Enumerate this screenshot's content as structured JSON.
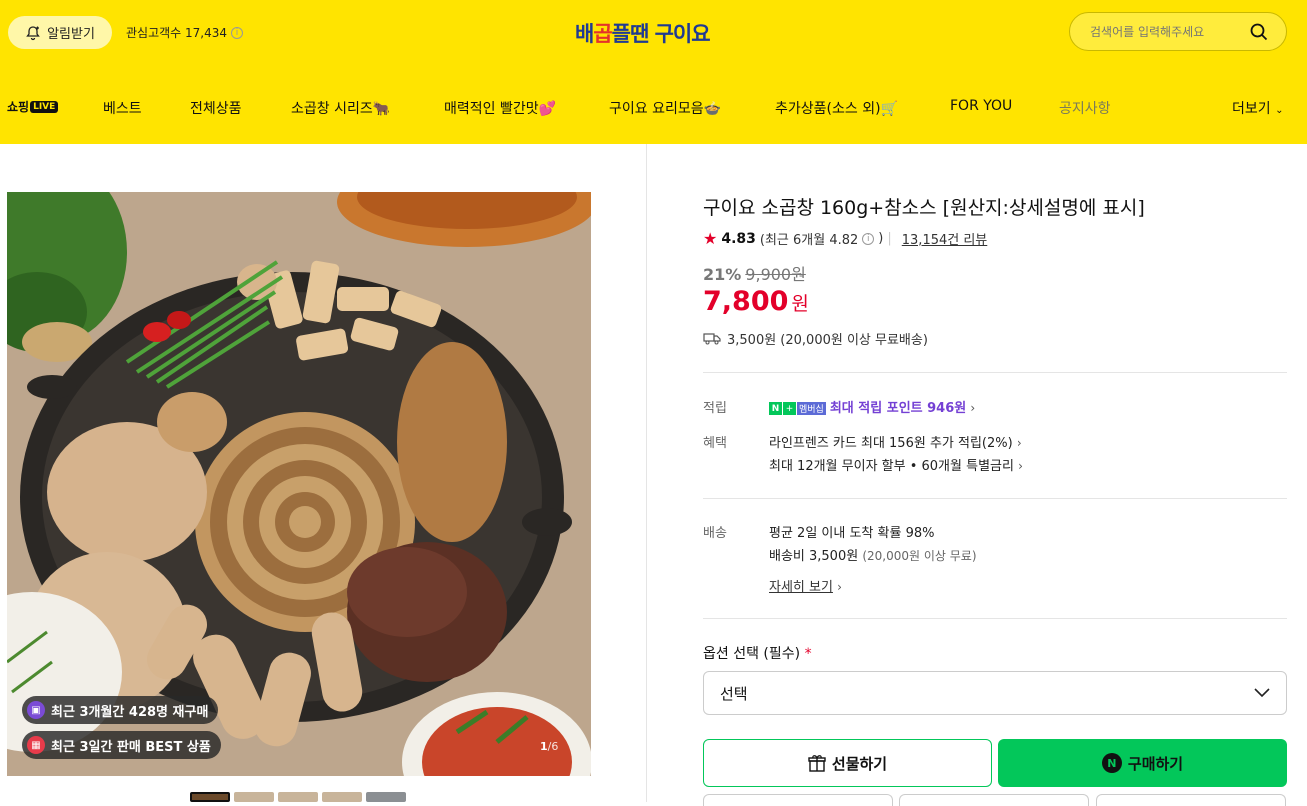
{
  "header": {
    "alarm_label": "알림받기",
    "interest_label": "관심고객수 17,434",
    "logo_part1": "배",
    "logo_part2": "곱",
    "logo_part3": "플땐 구이요",
    "search_placeholder": "검색어를 입력해주세요"
  },
  "nav": {
    "live_label": "쇼핑",
    "live_badge": "LIVE",
    "items": [
      "베스트",
      "전체상품",
      "소곱창 시리즈🐂",
      "매력적인 빨간맛💕",
      "구이요 요리모음🍲",
      "추가상품(소스 외)🛒",
      "FOR YOU",
      "공지사항"
    ],
    "more_label": "더보기"
  },
  "gallery": {
    "tag1": "최근 3개월간 428명 재구매",
    "tag2": "최근 3일간 판매 BEST 상품",
    "counter_current": "1",
    "counter_total": "/6"
  },
  "product": {
    "title": "구이요 소곱창 160g+참소스 [원산지:상세설명에 표시]",
    "rating": "4.83",
    "rating_recent": "(최근 6개월 4.82",
    "rating_close": ")",
    "review_count": "13,154건 리뷰",
    "discount_rate": "21%",
    "original_price": "9,900원",
    "price": "7,800",
    "price_unit": "원",
    "shipping": "3,500원 (20,000원 이상 무료배송)"
  },
  "benefits": {
    "point_label": "적립",
    "nplus_badge": "N",
    "nplus_plus": "+",
    "nplus_member": "멤버십",
    "point_text": "최대 적립 포인트 946원",
    "benefit_label": "혜택",
    "benefit_line1": "라인프렌즈 카드 최대 156원 추가 적립(2%)",
    "benefit_line2": "최대 12개월 무이자 할부 • 60개월 특별금리"
  },
  "delivery": {
    "label": "배송",
    "line1": "평균 2일 이내 도착 확률 98%",
    "line2": "배송비 3,500원",
    "line2_sub": "(20,000원 이상 무료)",
    "detail_link": "자세히 보기"
  },
  "options": {
    "label": "옵션 선택 (필수)",
    "required_mark": "*",
    "selected": "선택"
  },
  "actions": {
    "gift_label": "선물하기",
    "buy_label": "구매하기",
    "n_logo": "N"
  },
  "colors": {
    "header_bg": "#ffe400",
    "price_red": "#e3002a",
    "naver_green": "#03c75a",
    "point_purple": "#7440d4"
  }
}
